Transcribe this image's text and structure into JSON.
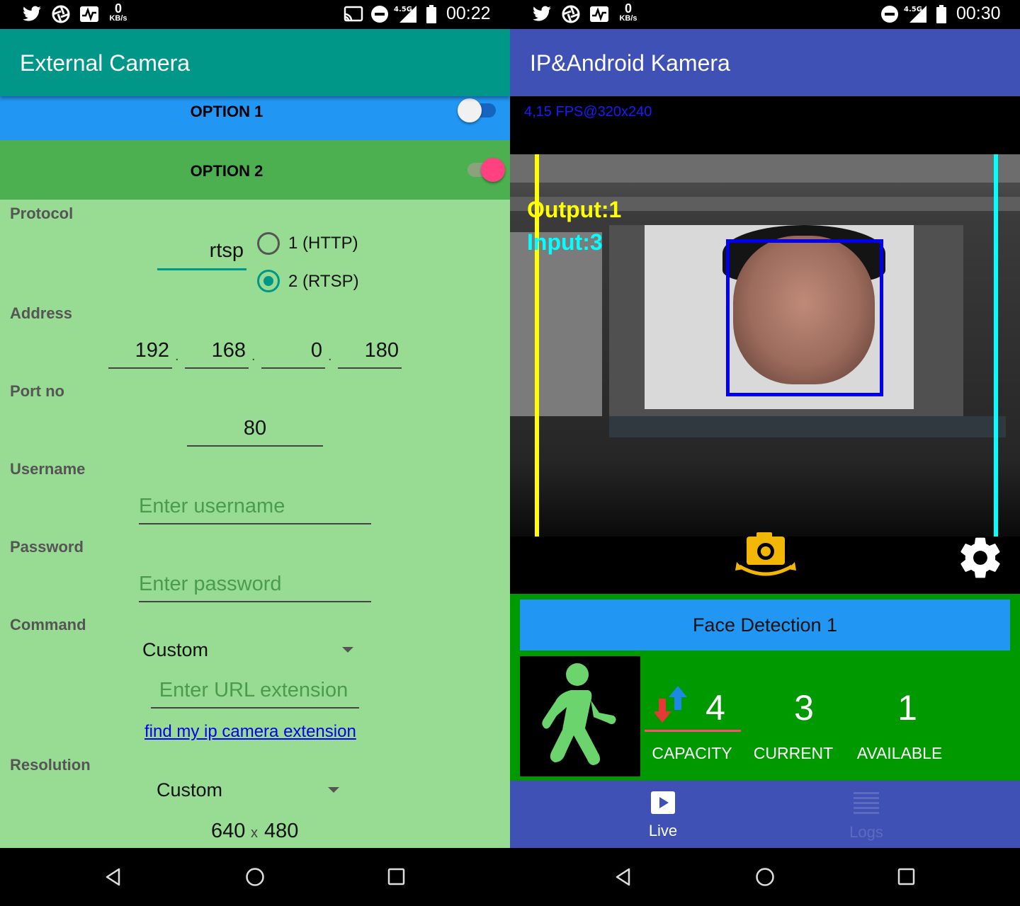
{
  "left": {
    "status": {
      "time": "00:22",
      "net_value": "0",
      "net_unit": "KB/s",
      "signal": "4.5G"
    },
    "appbar": {
      "title": "External Camera"
    },
    "option1": {
      "label": "OPTION 1",
      "enabled": false
    },
    "option2": {
      "label": "OPTION 2",
      "enabled": true
    },
    "protocol": {
      "label": "Protocol",
      "value": "rtsp",
      "options": [
        "1 (HTTP)",
        "2 (RTSP)"
      ],
      "selected": "2 (RTSP)"
    },
    "address": {
      "label": "Address",
      "octets": [
        "192",
        "168",
        "0",
        "180"
      ],
      "separator": "."
    },
    "port": {
      "label": "Port no",
      "value": "80"
    },
    "username": {
      "label": "Username",
      "placeholder": "Enter username"
    },
    "password": {
      "label": "Password",
      "placeholder": "Enter password"
    },
    "command": {
      "label": "Command",
      "selected": "Custom",
      "url_placeholder": "Enter URL extension",
      "link": "find my ip camera extension"
    },
    "resolution": {
      "label": "Resolution",
      "selected": "Custom",
      "width": "640",
      "x": "x",
      "height": "480"
    }
  },
  "right": {
    "status": {
      "time": "00:30",
      "net_value": "0",
      "net_unit": "KB/s",
      "signal": "4.5G"
    },
    "appbar": {
      "title": "IP&Android Kamera"
    },
    "fps_text": "4,15 FPS@320x240",
    "overlay": {
      "output": "Output:1",
      "input": "Input:3"
    },
    "detector": {
      "title": "Face Detection 1"
    },
    "stats": [
      {
        "key": "capacity",
        "value": "4",
        "label": "CAPACITY"
      },
      {
        "key": "current",
        "value": "3",
        "label": "CURRENT"
      },
      {
        "key": "available",
        "value": "1",
        "label": "AVAILABLE"
      }
    ],
    "bottom_nav": [
      {
        "label": "Live",
        "active": true
      },
      {
        "label": "Logs",
        "active": false
      }
    ]
  },
  "colors": {
    "left_appbar": "#009688",
    "option1_bg": "#2196f3",
    "option2_bg": "#4caf50",
    "form_bg": "#98dc94",
    "switch_on": "#ff4081",
    "right_appbar": "#3f51b5",
    "stats_bg": "#009900",
    "detector_bg": "#2196f3",
    "face_box": "#0000ee",
    "line_yellow": "#ffff00",
    "line_cyan": "#00ffff"
  }
}
